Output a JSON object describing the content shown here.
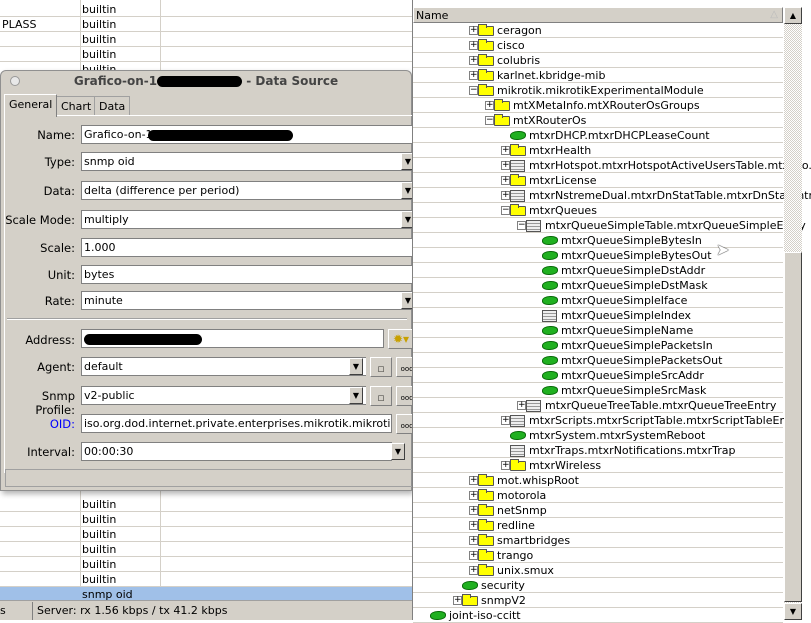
{
  "background_table": {
    "top_rows": [
      {
        "c1": "",
        "c2": "builtin"
      },
      {
        "c1": "PLASS",
        "c2": "builtin"
      },
      {
        "c1": "",
        "c2": "builtin"
      },
      {
        "c1": "",
        "c2": "builtin"
      },
      {
        "c1": "",
        "c2": "builtin"
      }
    ],
    "bottom_rows": [
      {
        "c2": "builtin"
      },
      {
        "c2": "builtin"
      },
      {
        "c2": "builtin"
      },
      {
        "c2": "builtin"
      },
      {
        "c2": "builtin"
      },
      {
        "c2": "builtin"
      },
      {
        "c2": "snmp oid",
        "selected": true
      }
    ],
    "status_left": "s",
    "status_server": "Server: rx 1.56 kbps / tx 41.2 kbps",
    "selection_color": "#a0c0e8"
  },
  "dialog": {
    "title_prefix": "Grafico-on-1",
    "title_suffix": " - Data Source",
    "tabs": [
      "General",
      "Chart",
      "Data"
    ],
    "active_tab": "General",
    "fields": {
      "name": {
        "label": "Name:",
        "value": "Grafico-on-1"
      },
      "type": {
        "label": "Type:",
        "value": "snmp oid"
      },
      "data": {
        "label": "Data:",
        "value": "delta (difference per period)"
      },
      "scale_mode": {
        "label": "Scale Mode:",
        "value": "multiply"
      },
      "scale": {
        "label": "Scale:",
        "value": "1.000"
      },
      "unit": {
        "label": "Unit:",
        "value": "bytes"
      },
      "rate": {
        "label": "Rate:",
        "value": "minute"
      },
      "address": {
        "label": "Address:",
        "value": ""
      },
      "agent": {
        "label": "Agent:",
        "value": "default"
      },
      "snmp_profile": {
        "label": "Snmp Profile:",
        "value": "v2-public"
      },
      "oid": {
        "label": "OID:",
        "value": "iso.org.dod.internet.private.enterprises.mikrotik.mikrotikExperin"
      },
      "interval": {
        "label": "Interval:",
        "value": "00:00:30"
      }
    },
    "oid_label_color": "#0000ff",
    "ellipsis_label": "ooo"
  },
  "tree": {
    "header": "Name",
    "items": [
      {
        "label": "ceragon",
        "level": 3,
        "icon": "folder",
        "expander": "+"
      },
      {
        "label": "cisco",
        "level": 3,
        "icon": "folder",
        "expander": "+"
      },
      {
        "label": "colubris",
        "level": 3,
        "icon": "folder",
        "expander": "+"
      },
      {
        "label": "karlnet.kbridge-mib",
        "level": 3,
        "icon": "folder",
        "expander": "+"
      },
      {
        "label": "mikrotik.mikrotikExperimentalModule",
        "level": 3,
        "icon": "folder",
        "expander": "-"
      },
      {
        "label": "mtXMetaInfo.mtXRouterOsGroups",
        "level": 4,
        "icon": "folder",
        "expander": "+"
      },
      {
        "label": "mtXRouterOs",
        "level": 4,
        "icon": "folder",
        "expander": "-"
      },
      {
        "label": "mtxrDHCP.mtxrDHCPLeaseCount",
        "level": 5,
        "icon": "leaf",
        "expander": ""
      },
      {
        "label": "mtxrHealth",
        "level": 5,
        "icon": "folder",
        "expander": "+"
      },
      {
        "label": "mtxrHotspot.mtxrHotspotActiveUsersTable.mtxrHo...",
        "level": 5,
        "icon": "table",
        "expander": "+"
      },
      {
        "label": "mtxrLicense",
        "level": 5,
        "icon": "folder",
        "expander": "+"
      },
      {
        "label": "mtxrNstremeDual.mtxrDnStatTable.mtxrDnStatEntry",
        "level": 5,
        "icon": "table",
        "expander": "+"
      },
      {
        "label": "mtxrQueues",
        "level": 5,
        "icon": "folder",
        "expander": "-"
      },
      {
        "label": "mtxrQueueSimpleTable.mtxrQueueSimpleEntry",
        "level": 6,
        "icon": "table",
        "expander": "-"
      },
      {
        "label": "mtxrQueueSimpleBytesIn",
        "level": 7,
        "icon": "leaf",
        "expander": ""
      },
      {
        "label": "mtxrQueueSimpleBytesOut",
        "level": 7,
        "icon": "leaf",
        "expander": ""
      },
      {
        "label": "mtxrQueueSimpleDstAddr",
        "level": 7,
        "icon": "leaf",
        "expander": ""
      },
      {
        "label": "mtxrQueueSimpleDstMask",
        "level": 7,
        "icon": "leaf",
        "expander": ""
      },
      {
        "label": "mtxrQueueSimpleIface",
        "level": 7,
        "icon": "leaf",
        "expander": ""
      },
      {
        "label": "mtxrQueueSimpleIndex",
        "level": 7,
        "icon": "table",
        "expander": ""
      },
      {
        "label": "mtxrQueueSimpleName",
        "level": 7,
        "icon": "leaf",
        "expander": ""
      },
      {
        "label": "mtxrQueueSimplePacketsIn",
        "level": 7,
        "icon": "leaf",
        "expander": ""
      },
      {
        "label": "mtxrQueueSimplePacketsOut",
        "level": 7,
        "icon": "leaf",
        "expander": ""
      },
      {
        "label": "mtxrQueueSimpleSrcAddr",
        "level": 7,
        "icon": "leaf",
        "expander": ""
      },
      {
        "label": "mtxrQueueSimpleSrcMask",
        "level": 7,
        "icon": "leaf",
        "expander": ""
      },
      {
        "label": "mtxrQueueTreeTable.mtxrQueueTreeEntry",
        "level": 6,
        "icon": "table",
        "expander": "+"
      },
      {
        "label": "mtxrScripts.mtxrScriptTable.mtxrScriptTableEntry",
        "level": 5,
        "icon": "table",
        "expander": "+"
      },
      {
        "label": "mtxrSystem.mtxrSystemReboot",
        "level": 5,
        "icon": "leaf",
        "expander": ""
      },
      {
        "label": "mtxrTraps.mtxrNotifications.mtxrTrap",
        "level": 5,
        "icon": "table",
        "expander": ""
      },
      {
        "label": "mtxrWireless",
        "level": 5,
        "icon": "folder",
        "expander": "+"
      },
      {
        "label": "mot.whispRoot",
        "level": 3,
        "icon": "folder",
        "expander": "+"
      },
      {
        "label": "motorola",
        "level": 3,
        "icon": "folder",
        "expander": "+"
      },
      {
        "label": "netSnmp",
        "level": 3,
        "icon": "folder",
        "expander": "+"
      },
      {
        "label": "redline",
        "level": 3,
        "icon": "folder",
        "expander": "+"
      },
      {
        "label": "smartbridges",
        "level": 3,
        "icon": "folder",
        "expander": "+"
      },
      {
        "label": "trango",
        "level": 3,
        "icon": "folder",
        "expander": "+"
      },
      {
        "label": "unix.smux",
        "level": 3,
        "icon": "folder",
        "expander": "+"
      },
      {
        "label": "security",
        "level": 2,
        "icon": "leaf",
        "expander": ""
      },
      {
        "label": "snmpV2",
        "level": 2,
        "icon": "folder",
        "expander": "+"
      },
      {
        "label": "joint-iso-ccitt",
        "level": 0,
        "icon": "leaf",
        "expander": ""
      }
    ]
  }
}
